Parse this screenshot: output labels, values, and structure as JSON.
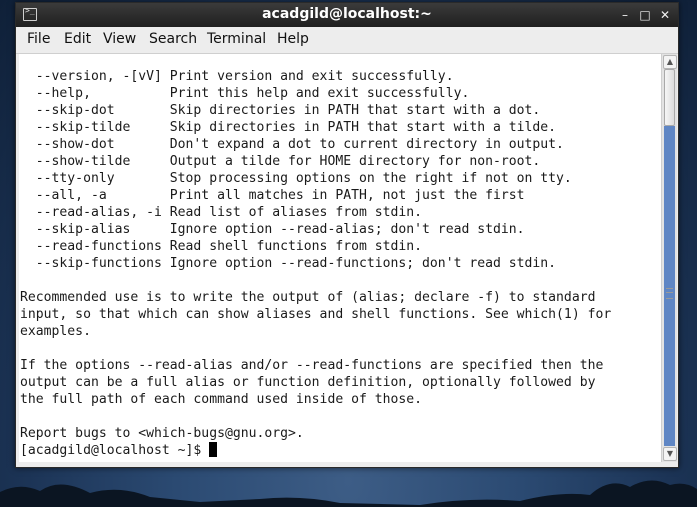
{
  "window": {
    "title": "acadgild@localhost:~",
    "controls": {
      "minimize": "–",
      "maximize": "□",
      "close": "✕"
    }
  },
  "menu": {
    "items": [
      "File",
      "Edit",
      "View",
      "Search",
      "Terminal",
      "Help"
    ]
  },
  "terminal": {
    "lines": [
      "  --version, -[vV] Print version and exit successfully.",
      "  --help,          Print this help and exit successfully.",
      "  --skip-dot       Skip directories in PATH that start with a dot.",
      "  --skip-tilde     Skip directories in PATH that start with a tilde.",
      "  --show-dot       Don't expand a dot to current directory in output.",
      "  --show-tilde     Output a tilde for HOME directory for non-root.",
      "  --tty-only       Stop processing options on the right if not on tty.",
      "  --all, -a        Print all matches in PATH, not just the first",
      "  --read-alias, -i Read list of aliases from stdin.",
      "  --skip-alias     Ignore option --read-alias; don't read stdin.",
      "  --read-functions Read shell functions from stdin.",
      "  --skip-functions Ignore option --read-functions; don't read stdin.",
      "",
      "Recommended use is to write the output of (alias; declare -f) to standard",
      "input, so that which can show aliases and shell functions. See which(1) for",
      "examples.",
      "",
      "If the options --read-alias and/or --read-functions are specified then the",
      "output can be a full alias or function definition, optionally followed by",
      "the full path of each command used inside of those.",
      "",
      "Report bugs to <which-bugs@gnu.org>."
    ],
    "prompt": "[acadgild@localhost ~]$ "
  },
  "scrollbar": {
    "position_fraction": 1.0,
    "visible_fraction": 0.15
  },
  "icons": {
    "app": "terminal-icon",
    "scroll_up": "scroll-up-arrow-icon",
    "scroll_down": "scroll-down-arrow-icon"
  }
}
